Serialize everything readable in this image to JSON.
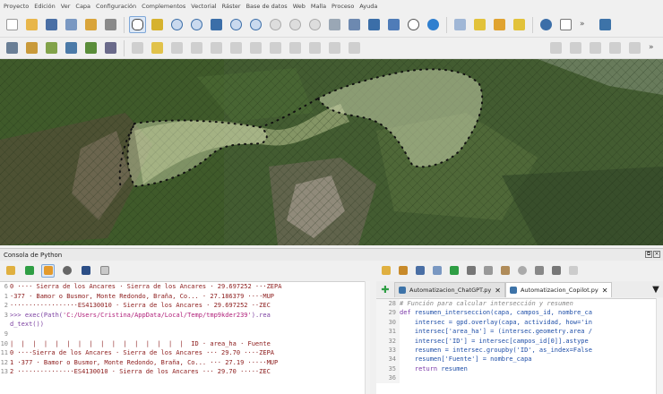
{
  "menu": [
    "Proyecto",
    "Edición",
    "Ver",
    "Capa",
    "Configuración",
    "Complementos",
    "Vectorial",
    "Ráster",
    "Base de datos",
    "Web",
    "Malla",
    "Proceso",
    "Ayuda"
  ],
  "console": {
    "title": "Consola de Python",
    "lines": [
      {
        "num": "6",
        "text": "0 ···· Sierra de los Ancares · Sierra de los Ancares · 29.697252 ···ZEPA",
        "style": "out"
      },
      {
        "num": "1",
        "text": "·377 · Bamor o Busmor, Monte Redondo, Braña, Co... · 27.186379 ····MUP",
        "style": "out"
      },
      {
        "num": "2",
        "text": "··················ES4130010 · Sierra de los Ancares · 29.697252 ··ZEC",
        "style": "out"
      },
      {
        "num": "3",
        "prompt": ">>> exec(Path(",
        "path": "'C:/Users/Cristina/AppData/Local/Temp/tmp9kder239'",
        "rest": ").rea",
        "style": "py"
      },
      {
        "num": "",
        "text": "d_text())",
        "style": "py"
      },
      {
        "num": "9",
        "text": "",
        "style": "out"
      },
      {
        "num": "10",
        "text": "|  |  |  |  |  |  |  |  |  |  |  |  |  |  |  |  ID · area_ha · Fuente",
        "style": "out"
      },
      {
        "num": "11",
        "text": "0 ····Sierra de los Ancares · Sierra de los Ancares ··· 29.70 ····ZEPA",
        "style": "out"
      },
      {
        "num": "12",
        "text": "1 ·377 · Bamor o Busmor, Monte Redondo, Braña, Co... ··· 27.19 ·····MUP",
        "style": "out"
      },
      {
        "num": "13",
        "text": "2 ···············ES4130010 · Sierra de los Ancares ··· 29.70 ·····ZEC",
        "style": "out"
      }
    ]
  },
  "editor": {
    "tabs": [
      {
        "label": "Automatizacion_ChatGPT.py",
        "close": "✕"
      },
      {
        "label": "Automatizacion_Copilot.py",
        "close": "✕"
      }
    ],
    "lines": [
      {
        "num": "28",
        "type": "comment",
        "text": "# Función para calcular intersección y resumen"
      },
      {
        "num": "29",
        "type": "def",
        "kw": "def ",
        "text": "resumen_interseccion(capa, campos_id, nombre_ca"
      },
      {
        "num": "30",
        "type": "code",
        "text": "    intersec = gpd.overlay(capa, actividad, how='in"
      },
      {
        "num": "31",
        "type": "code",
        "text": "    intersec['area_ha'] = (intersec.geometry.area /"
      },
      {
        "num": "32",
        "type": "code",
        "text": "    intersec['ID'] = intersec[campos_id[0]].astype"
      },
      {
        "num": "33",
        "type": "code",
        "text": "    resumen = intersec.groupby('ID', as_index=False"
      },
      {
        "num": "34",
        "type": "code",
        "text": "    resumen['Fuente'] = nombre_capa"
      },
      {
        "num": "35",
        "type": "return",
        "kw": "    return ",
        "text": "resumen"
      },
      {
        "num": "36",
        "type": "code",
        "text": ""
      }
    ]
  }
}
